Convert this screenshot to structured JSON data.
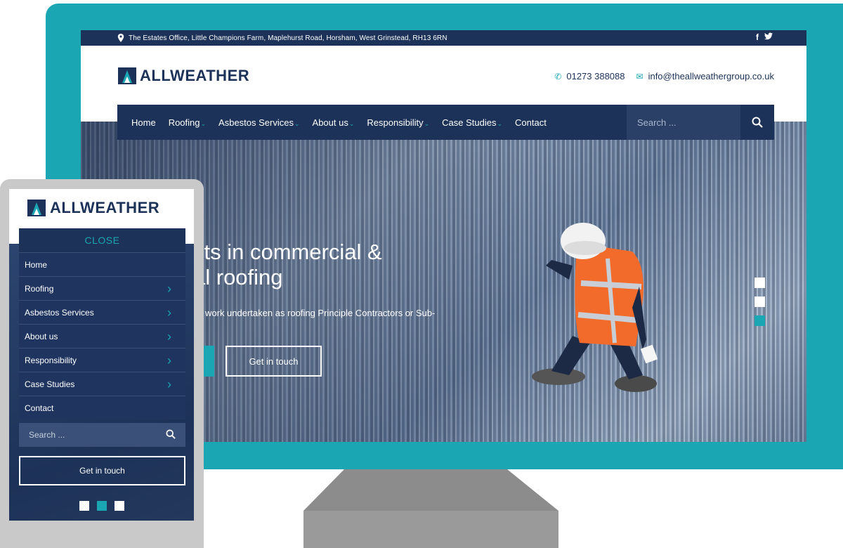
{
  "desktop": {
    "topbar": {
      "address": "The Estates Office, Little Champions Farm, Maplehurst Road, Horsham, West Grinstead, RH13 6RN",
      "facebook": "f",
      "twitter": "🐦"
    },
    "logo": {
      "word": "ALLWEATHER"
    },
    "contact": {
      "phone": "01273 388088",
      "email": "info@theallweathergroup.co.uk"
    },
    "nav": {
      "items": [
        {
          "label": "Home",
          "dropdown": false
        },
        {
          "label": "Roofing",
          "dropdown": true
        },
        {
          "label": "Asbestos Services",
          "dropdown": true
        },
        {
          "label": "About us",
          "dropdown": true
        },
        {
          "label": "Responsibility",
          "dropdown": true
        },
        {
          "label": "Case Studies",
          "dropdown": true
        },
        {
          "label": "Contact",
          "dropdown": false
        }
      ],
      "search_placeholder": "Search ..."
    },
    "hero": {
      "title_line1": "sts in commercial &",
      "title_line2": "al roofing",
      "subtitle": "work undertaken as roofing Principle Contractors or Sub-",
      "cta": "Get in touch",
      "slides": 3,
      "active_slide": 3
    }
  },
  "mobile": {
    "logo": {
      "word": "ALLWEATHER"
    },
    "close_label": "CLOSE",
    "menu": [
      {
        "label": "Home",
        "submenu": false
      },
      {
        "label": "Roofing",
        "submenu": true
      },
      {
        "label": "Asbestos Services",
        "submenu": true
      },
      {
        "label": "About us",
        "submenu": true
      },
      {
        "label": "Responsibility",
        "submenu": true
      },
      {
        "label": "Case Studies",
        "submenu": true
      },
      {
        "label": "Contact",
        "submenu": false
      }
    ],
    "search_placeholder": "Search ...",
    "cta": "Get in touch",
    "slides": 3,
    "active_slide": 2
  },
  "colors": {
    "navy": "#1d3258",
    "teal": "#1aa6b3",
    "device_gray": "#c9c9c9"
  }
}
